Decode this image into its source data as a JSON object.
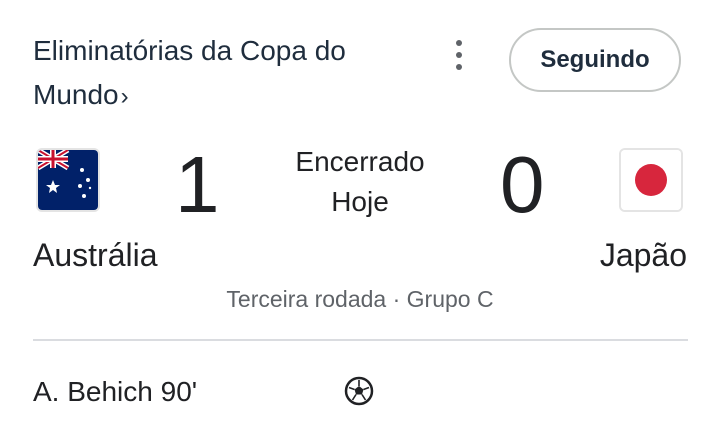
{
  "header": {
    "competition": "Eliminatórias da Copa do Mundo",
    "competition_line2": "Mundo",
    "chevron": "›",
    "follow_label": "Seguindo",
    "more_icon": "vertical-dots-icon"
  },
  "match": {
    "home_team": "Austrália",
    "away_team": "Japão",
    "home_score": "1",
    "away_score": "0",
    "status": "Encerrado",
    "date": "Hoje",
    "round": "Terceira rodada · Grupo C",
    "home_flag_icon": "australia-flag-icon",
    "away_flag_icon": "japan-flag-icon"
  },
  "events": [
    {
      "player": "A. Behich 90'",
      "icon": "soccer-ball-icon"
    }
  ],
  "colors": {
    "title": "#1f2d3d",
    "text": "#202124",
    "muted": "#5f6368",
    "divider": "#dadce0",
    "jp_red": "#d7263d",
    "au_blue": "#012169"
  }
}
